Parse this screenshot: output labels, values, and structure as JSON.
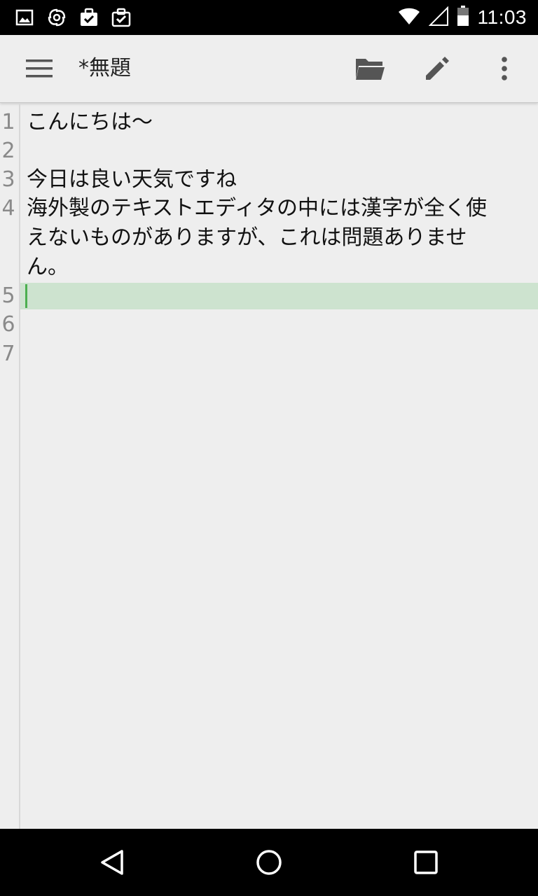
{
  "status_bar": {
    "time": "11:03",
    "left_icons": [
      "image-notification-icon",
      "sync-notification-icon",
      "task-notification-icon",
      "task-list-notification-icon"
    ],
    "right_icons": [
      "wifi-icon",
      "cellular-signal-icon",
      "battery-icon"
    ]
  },
  "toolbar": {
    "title": "*無題",
    "actions": [
      "folder-open-icon",
      "edit-pencil-icon",
      "more-vert-icon"
    ]
  },
  "editor": {
    "line_numbers": [
      "1",
      "2",
      "3",
      "4",
      "5",
      "6",
      "7"
    ],
    "lines": [
      "こんにちは～",
      "",
      "今日は良い天気ですね",
      "海外製のテキストエディタの中には漢字が全く使",
      "えないものがありますが、これは問題ありませ",
      "ん。",
      "",
      "",
      ""
    ],
    "current_line": 5
  },
  "colors": {
    "background": "#eeeeee",
    "current_line_highlight": "#cde3cf",
    "cursor": "#4caf50",
    "system_bars": "#000000"
  }
}
